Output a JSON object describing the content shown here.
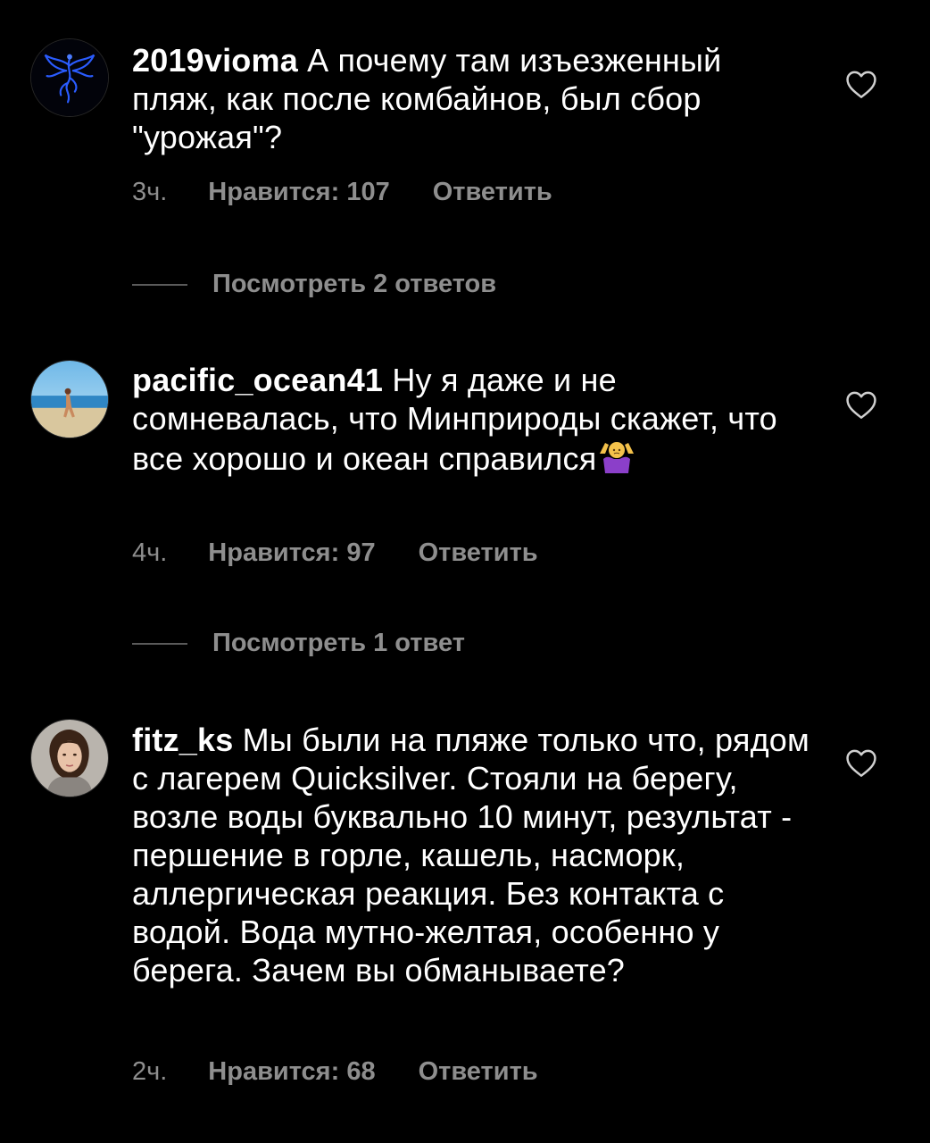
{
  "comments": [
    {
      "username": "2019vioma",
      "text": " А почему там изъезженный пляж, как после комбайнов, был сбор \"урожая\"?",
      "time": "3ч.",
      "likes": "Нравится: 107",
      "reply": "Ответить",
      "view_replies": "Посмотреть 2 ответов",
      "avatar_icon": "blue-phoenix-avatar"
    },
    {
      "username": "pacific_ocean41",
      "text": " Ну я даже и не сомневалась, что Минприроды скажет, что все хорошо и океан справился",
      "emoji": "person-shrugging-emoji",
      "time": "4ч.",
      "likes": "Нравится: 97",
      "reply": "Ответить",
      "view_replies": "Посмотреть 1 ответ",
      "avatar_icon": "beach-photo-avatar"
    },
    {
      "username": "fitz_ks",
      "text": " Мы были на пляже только что, рядом с лагерем Quicksilver. Стояли на берегу, возле воды буквально 10 минут, результат - першение в горле, кашель, насморк, аллергическая реакция. Без контакта с водой. Вода мутно-желтая, особенно у берега. Зачем вы обманываете?",
      "time": "2ч.",
      "likes": "Нравится: 68",
      "reply": "Ответить",
      "avatar_icon": "portrait-photo-avatar"
    }
  ],
  "colors": {
    "background": "#000000",
    "text": "#ffffff",
    "secondary": "#8e8e8e"
  }
}
